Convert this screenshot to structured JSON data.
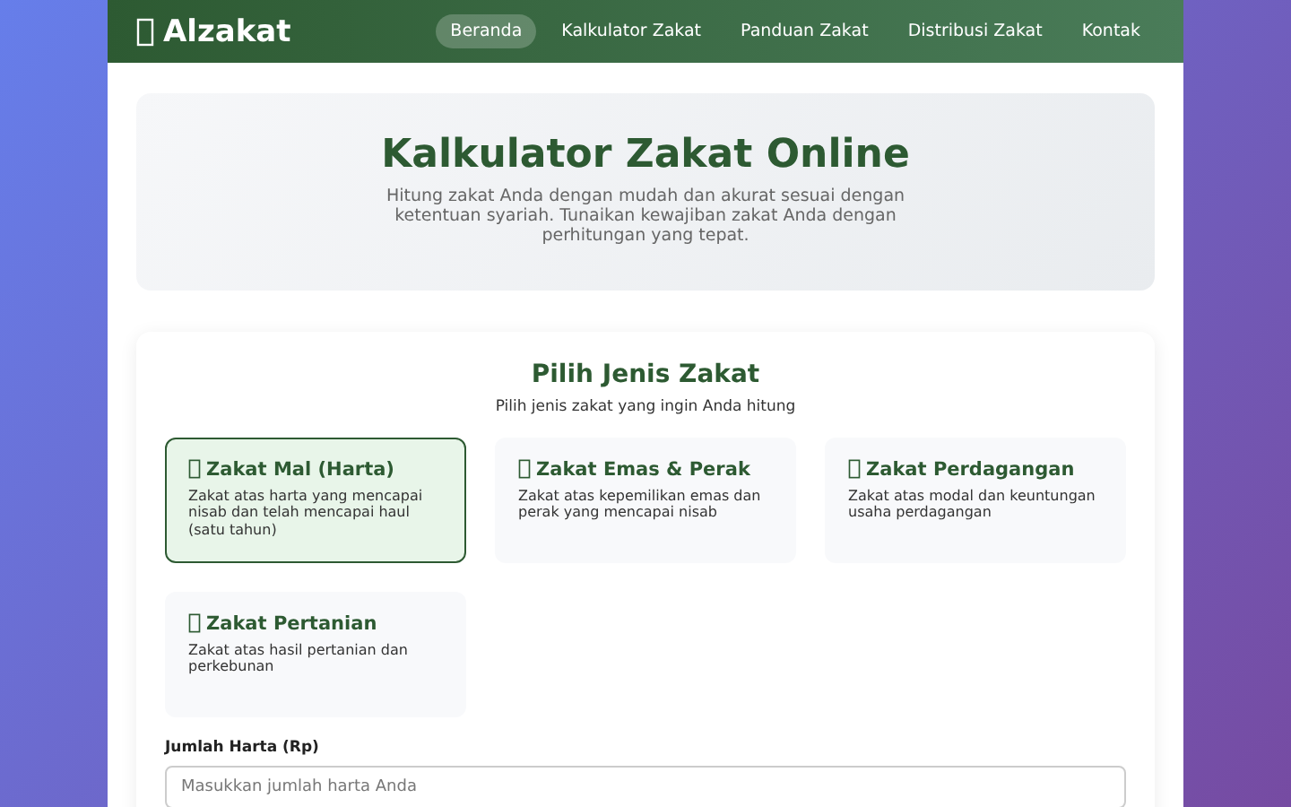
{
  "header": {
    "logo": "Alzakat",
    "nav": [
      {
        "label": "Beranda",
        "selected": true
      },
      {
        "label": "Kalkulator Zakat",
        "selected": false
      },
      {
        "label": "Panduan Zakat",
        "selected": false
      },
      {
        "label": "Distribusi Zakat",
        "selected": false
      },
      {
        "label": "Kontak",
        "selected": false
      }
    ]
  },
  "hero": {
    "title": "Kalkulator Zakat Online",
    "subtitle": "Hitung zakat Anda dengan mudah dan akurat sesuai dengan ketentuan syariah. Tunaikan kewajiban zakat Anda dengan perhitungan yang tepat."
  },
  "section": {
    "title": "Pilih Jenis Zakat",
    "subtitle": "Pilih jenis zakat yang ingin Anda hitung",
    "types": [
      {
        "title": "Zakat Mal (Harta)",
        "description": "Zakat atas harta yang mencapai nisab dan telah mencapai haul (satu tahun)",
        "selected": true
      },
      {
        "title": "Zakat Emas & Perak",
        "description": "Zakat atas kepemilikan emas dan perak yang mencapai nisab",
        "selected": false
      },
      {
        "title": "Zakat Perdagangan",
        "description": "Zakat atas modal dan keuntungan usaha perdagangan",
        "selected": false
      },
      {
        "title": "Zakat Pertanian",
        "description": "Zakat atas hasil pertanian dan perkebunan",
        "selected": false
      }
    ]
  },
  "form": {
    "label": "Jumlah Harta (Rp)",
    "placeholder": "Masukkan jumlah harta Anda"
  }
}
